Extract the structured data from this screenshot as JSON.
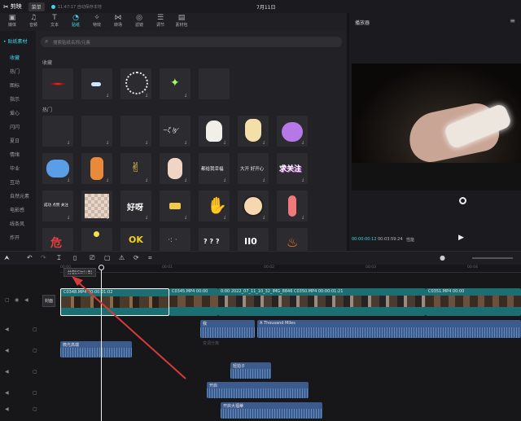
{
  "titlebar": {
    "app_name": "剪映",
    "menu_label": "菜单",
    "autosave": "11:47:17 自动保存本地",
    "project_title": "7月11日"
  },
  "toolbar": {
    "items": [
      {
        "label": "媒体",
        "icon": "media-icon"
      },
      {
        "label": "音频",
        "icon": "audio-icon"
      },
      {
        "label": "文本",
        "icon": "text-icon"
      },
      {
        "label": "贴纸",
        "icon": "sticker-icon"
      },
      {
        "label": "特效",
        "icon": "effects-icon"
      },
      {
        "label": "转场",
        "icon": "transition-icon"
      },
      {
        "label": "滤镜",
        "icon": "filter-icon"
      },
      {
        "label": "调节",
        "icon": "adjust-icon"
      },
      {
        "label": "素材包",
        "icon": "package-icon"
      }
    ],
    "active": "贴纸"
  },
  "left_nav": {
    "header": "• 贴纸素材",
    "items": [
      "收藏",
      "热门",
      "图标",
      "指示",
      "爱心",
      "闪闪",
      "夏日",
      "情绪",
      "毕业",
      "互动",
      "自然元素",
      "电影感",
      "线条风",
      "炸开"
    ],
    "active": "收藏"
  },
  "catalog": {
    "search_placeholder": "搜索贴纸名称/元素",
    "section_favorites": "收藏",
    "section_hot": "热门",
    "tile_texts": {
      "hello": "Hello",
      "qiuguanzhu": "求关注",
      "haoya": "好呀",
      "script1": "都给我幸福",
      "script2": "大开 好开心",
      "tag_green": "成功 点赞 关注",
      "ok": "OK",
      "chat": "? ? ?",
      "pause": "II0",
      "red": "危"
    }
  },
  "player": {
    "title": "播放器",
    "time_current": "00:00:00:12",
    "time_total": "00:03:59:24",
    "quality": "性能"
  },
  "timeline": {
    "tooltip": "分割(Ctrl+B)",
    "ruler": [
      "00:00",
      "00:01",
      "00:02",
      "00:03",
      "00:04"
    ],
    "cover_label": "封面",
    "video_clips": [
      {
        "name": "C0348.MP4  00:00:01:02"
      },
      {
        "name": "C0345.MP4  00:00"
      },
      {
        "name": "0:00  2022_07_11_10_32_IMG_8846  C0350.MP4  00:00:01:21"
      },
      {
        "name": "C0351.MP4  00:00"
      }
    ],
    "audio_clips": [
      {
        "name": "我"
      },
      {
        "name": "A Thousand Miles"
      },
      {
        "name": "微光高端"
      },
      {
        "name": "轻拍子"
      },
      {
        "name": "开启"
      },
      {
        "name": "开启大福蒂"
      },
      {
        "name": "变调分离"
      }
    ]
  },
  "colors": {
    "accent": "#3ed6e8",
    "video_track": "#1b6f73",
    "audio_track": "#3d5a8c",
    "selection": "#ffffff",
    "arrow": "#d63a3a"
  }
}
